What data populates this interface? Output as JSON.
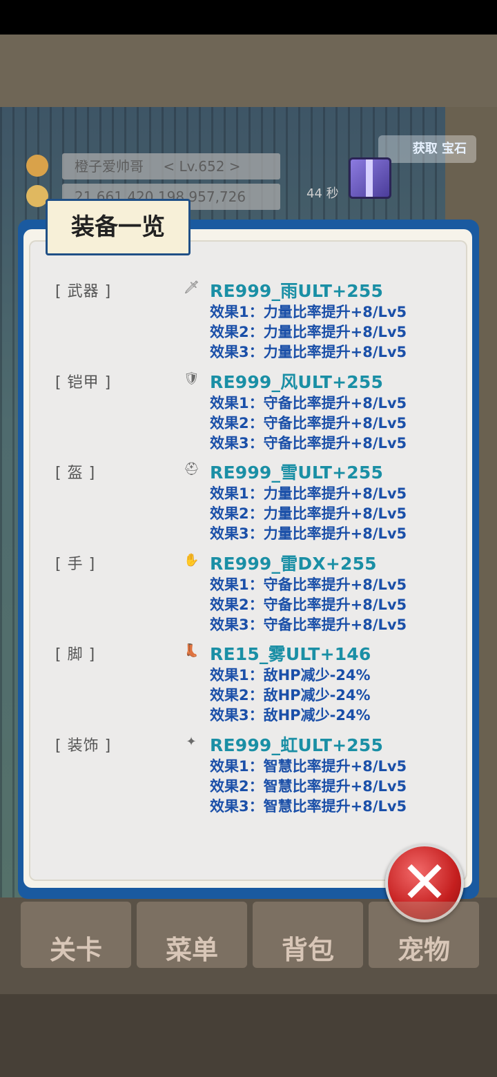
{
  "player": {
    "name": "橙子爱帅哥",
    "level": "< Lv.652 >",
    "gold": "21,661,420,198,957,726",
    "timer": "44 秒"
  },
  "promo": {
    "label": "获取 宝石"
  },
  "dialog": {
    "title": "装备一览",
    "slots": [
      {
        "label": "[ 武器 ]",
        "icon": "sword-icon",
        "name": "RE999_雨ULT+255",
        "effects": [
          "效果1：力量比率提升+8/Lv5",
          "效果2：力量比率提升+8/Lv5",
          "效果3：力量比率提升+8/Lv5"
        ]
      },
      {
        "label": "[ 铠甲 ]",
        "icon": "armor-icon",
        "name": "RE999_风ULT+255",
        "effects": [
          "效果1：守备比率提升+8/Lv5",
          "效果2：守备比率提升+8/Lv5",
          "效果3：守备比率提升+8/Lv5"
        ]
      },
      {
        "label": "[ 盔 ]",
        "icon": "helmet-icon",
        "name": "RE999_雪ULT+255",
        "effects": [
          "效果1：力量比率提升+8/Lv5",
          "效果2：力量比率提升+8/Lv5",
          "效果3：力量比率提升+8/Lv5"
        ]
      },
      {
        "label": "[ 手 ]",
        "icon": "glove-icon",
        "name": "RE999_雷DX+255",
        "effects": [
          "效果1：守备比率提升+8/Lv5",
          "效果2：守备比率提升+8/Lv5",
          "效果3：守备比率提升+8/Lv5"
        ]
      },
      {
        "label": "[ 脚 ]",
        "icon": "boot-icon",
        "name": "RE15_雾ULT+146",
        "effects": [
          "效果1：敌HP减少-24%",
          "效果2：敌HP减少-24%",
          "效果3：敌HP减少-24%"
        ]
      },
      {
        "label": "[ 装饰 ]",
        "icon": "accessory-icon",
        "name": "RE999_虹ULT+255",
        "effects": [
          "效果1：智慧比率提升+8/Lv5",
          "效果2：智慧比率提升+8/Lv5",
          "效果3：智慧比率提升+8/Lv5"
        ]
      }
    ]
  },
  "nav": [
    "关卡",
    "菜单",
    "背包",
    "宠物"
  ],
  "colors": {
    "item_name": "#1a8fa5",
    "effect_text": "#1a4fa8",
    "dialog_border": "#1a5aa0",
    "close_red": "#c51f1f"
  }
}
